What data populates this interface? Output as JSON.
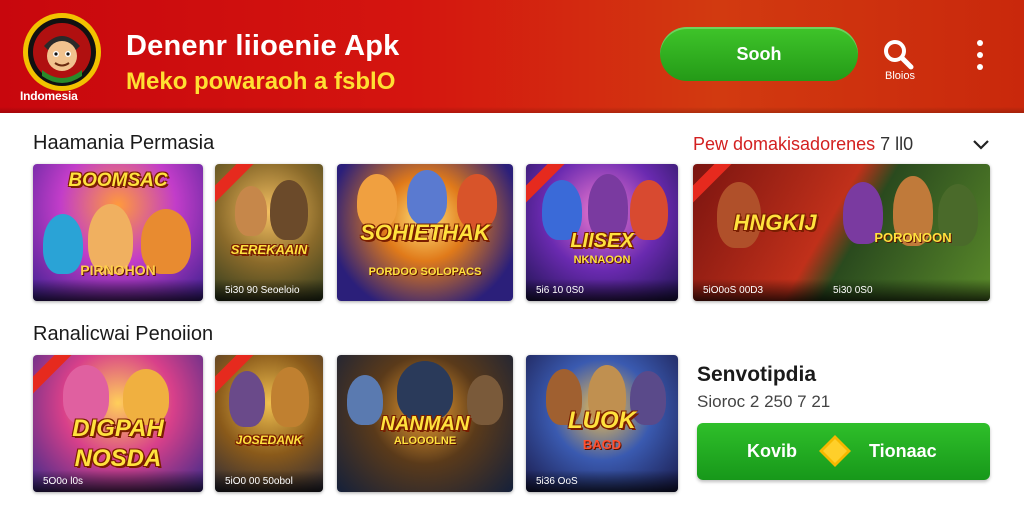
{
  "header": {
    "logo_text": "Indomesia",
    "title": "Denenr liioenie Apk",
    "subtitle": "Meko powaraoh a fsblO",
    "search_button_label": "Sooh",
    "search_icon_label": "Bloios",
    "colors": {
      "bar": "#c8070d",
      "subtitle": "#ffe032",
      "button": "#2fae1f"
    }
  },
  "section1": {
    "title": "Haamania Permasia",
    "promo_text": "Pew domakisadorenes",
    "promo_number": "7 ll0",
    "cards": [
      {
        "logo": "BOOMSAC",
        "sub": "PIRNOHON",
        "caption": ""
      },
      {
        "logo": "SEREKAAIN",
        "sub": "",
        "caption": "5i30 90 Seoeloio"
      },
      {
        "logo": "SOHIETHAK",
        "sub": "PORDOO SOLOPACS",
        "caption": ""
      },
      {
        "logo": "LIISEX",
        "sub": "NKNAOON",
        "caption": "5i6 10 0S0"
      },
      {
        "logo": "HNGKIJ",
        "sub": "PORONOON",
        "caption": "5iO0oS 00D3"
      }
    ],
    "card5_caption2": "5i30 0S0"
  },
  "section2": {
    "title": "Ranalicwai Penoiion",
    "cards": [
      {
        "logo": "DIGPAH",
        "sub": "NOSDA",
        "caption": "5O0o l0s"
      },
      {
        "logo": "JOSEDANK",
        "sub": "",
        "caption": "5iO0 00 50obol"
      },
      {
        "logo": "NANMAN",
        "sub": "ALOOOLNE",
        "caption": ""
      },
      {
        "logo": "LUOK",
        "sub": "BAGD",
        "caption": "5i36 OoS"
      }
    ]
  },
  "info": {
    "title": "Senvotipdia",
    "subtitle": "Sioroc 2 250 7 21",
    "cta_left": "Kovib",
    "cta_right": "Tionaac",
    "cta_colors": {
      "button": "#22a822",
      "diamond": "#f6b800"
    }
  }
}
